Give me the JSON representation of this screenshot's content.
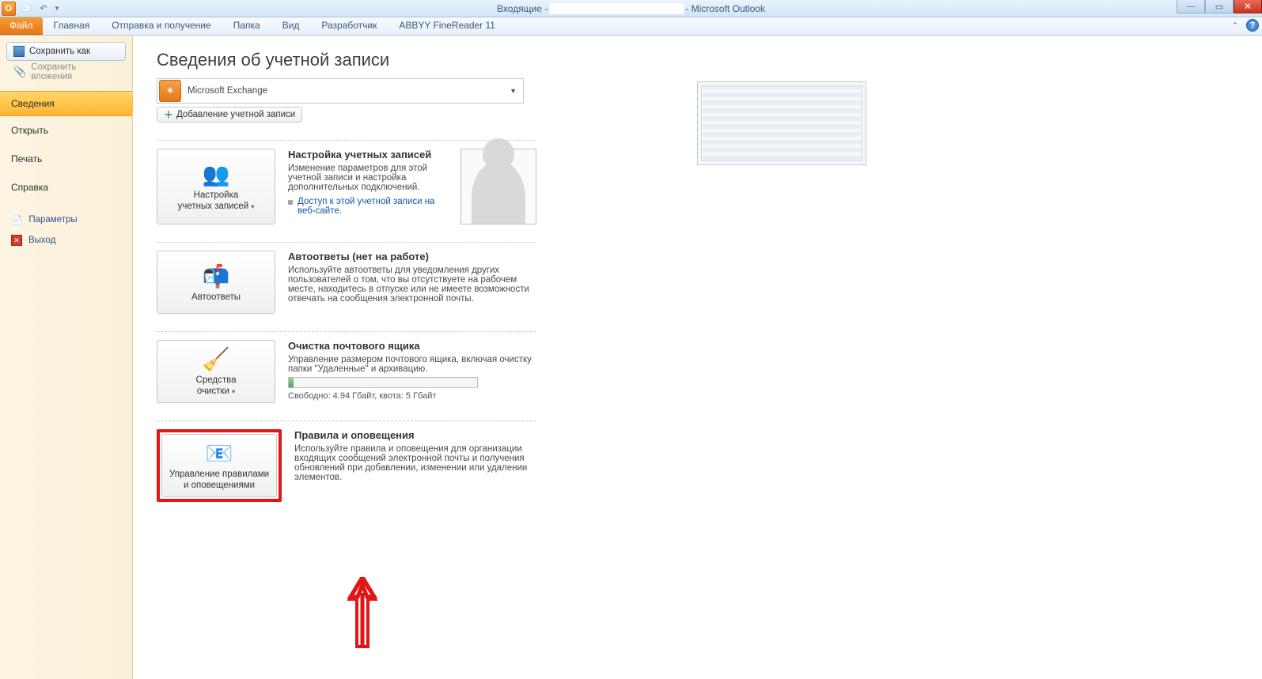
{
  "titlebar": {
    "inbox_prefix": "Входящие -",
    "app_suffix": "- Microsoft Outlook"
  },
  "ribbon": {
    "file": "Файл",
    "tabs": [
      "Главная",
      "Отправка и получение",
      "Папка",
      "Вид",
      "Разработчик",
      "ABBYY FineReader 11"
    ]
  },
  "nav": {
    "save_as": "Сохранить как",
    "save_attach": "Сохранить вложения",
    "info": "Сведения",
    "open": "Открыть",
    "print": "Печать",
    "help": "Справка",
    "options": "Параметры",
    "exit": "Выход"
  },
  "content": {
    "page_title": "Сведения об учетной записи",
    "account_selected": "Microsoft Exchange",
    "add_account": "Добавление учетной записи",
    "section_accounts": {
      "btn": "Настройка\nучетных записей",
      "btn_line1": "Настройка",
      "btn_line2": "учетных записей",
      "h": "Настройка учетных записей",
      "p": "Изменение параметров для этой учетной записи и настройка дополнительных подключений.",
      "bullet": "Доступ к этой учетной записи на веб-сайте."
    },
    "section_auto": {
      "btn": "Автоответы",
      "h": "Автоответы (нет на работе)",
      "p": "Используйте автоответы для уведомления других пользователей о том, что вы отсутствуете на рабочем месте, находитесь в отпуске или не имеете возможности отвечать на сообщения электронной почты."
    },
    "section_clean": {
      "btn_line1": "Средства",
      "btn_line2": "очистки",
      "h": "Очистка почтового ящика",
      "p": "Управление размером почтового ящика, включая очистку папки \"Удаленные\" и архивацию.",
      "quota": "Свободно: 4.94 Гбайт, квота: 5 Гбайт"
    },
    "section_rules": {
      "btn_line1": "Управление правилами",
      "btn_line2": "и оповещениями",
      "h": "Правила и оповещения",
      "p": "Используйте правила и оповещения для организации входящих сообщений электронной почты и получения обновлений при добавлении, изменении или удалении элементов."
    }
  }
}
